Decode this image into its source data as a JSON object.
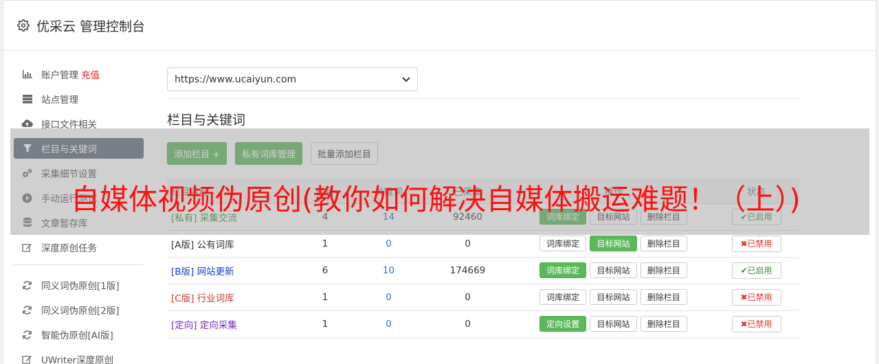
{
  "header": {
    "title": "优采云 管理控制台"
  },
  "sidebar": {
    "items": [
      {
        "label": "账户管理",
        "extra": "充值",
        "icon": "bar-chart-icon"
      },
      {
        "label": "站点管理",
        "icon": "server-icon"
      },
      {
        "label": "接口文件相关",
        "icon": "cloud-upload-icon"
      },
      {
        "label": "栏目与关键词",
        "icon": "filter-icon",
        "active": true
      },
      {
        "label": "采集细节设置",
        "icon": "cogs-icon"
      },
      {
        "label": "手动运行测试",
        "icon": "play-circle-icon"
      },
      {
        "label": "文章暂存库",
        "icon": "database-icon"
      },
      {
        "label": "深度原创任务",
        "icon": "edit-icon"
      }
    ],
    "items2": [
      {
        "label": "同义词伪原创[1版]",
        "icon": "refresh-icon"
      },
      {
        "label": "同义词伪原创[2版]",
        "icon": "refresh-icon"
      },
      {
        "label": "智能伪原创[AI版]",
        "icon": "refresh-icon"
      },
      {
        "label": "UWriter深度原创",
        "icon": "edit-icon"
      }
    ]
  },
  "main": {
    "site_select": "https://www.ucaiyun.com",
    "section_title": "栏目与关键词",
    "toolbar": {
      "add": "添加栏目 +",
      "private": "私有词库管理",
      "batch": "批量添加栏目"
    },
    "table": {
      "headers": [
        "栏目名称",
        "栏目",
        "关键词",
        "已采集",
        "操作",
        "状态"
      ],
      "rows": [
        {
          "tag": "[私有]",
          "name": "采集交流",
          "a": "4",
          "b": "14",
          "c": "92460",
          "bind": "词库绑定",
          "target": "目标网站",
          "del": "删除栏目",
          "status": "已启用"
        },
        {
          "tag": "[A版]",
          "name": "公有词库",
          "a": "1",
          "b": "0",
          "c": "0",
          "bind": "词库绑定",
          "target": "目标网站",
          "del": "删除栏目",
          "status": "已禁用"
        },
        {
          "tag": "[B版]",
          "name": "网站更新",
          "a": "6",
          "b": "10",
          "c": "174669",
          "bind": "词库绑定",
          "target": "目标网站",
          "del": "删除栏目",
          "status": "已启用"
        },
        {
          "tag": "[C版]",
          "name": "行业词库",
          "a": "1",
          "b": "0",
          "c": "0",
          "bind": "词库绑定",
          "target": "目标网站",
          "del": "删除栏目",
          "status": "已禁用"
        },
        {
          "tag": "[定向]",
          "name": "定向采集",
          "a": "1",
          "b": "0",
          "c": "0",
          "bind": "定向设置",
          "target": "目标网站",
          "del": "删除栏目",
          "status": "已禁用"
        }
      ]
    }
  },
  "overlay": {
    "text": "自媒体视频伪原创(教你如何解决自媒体搬运难题！（上）)"
  }
}
